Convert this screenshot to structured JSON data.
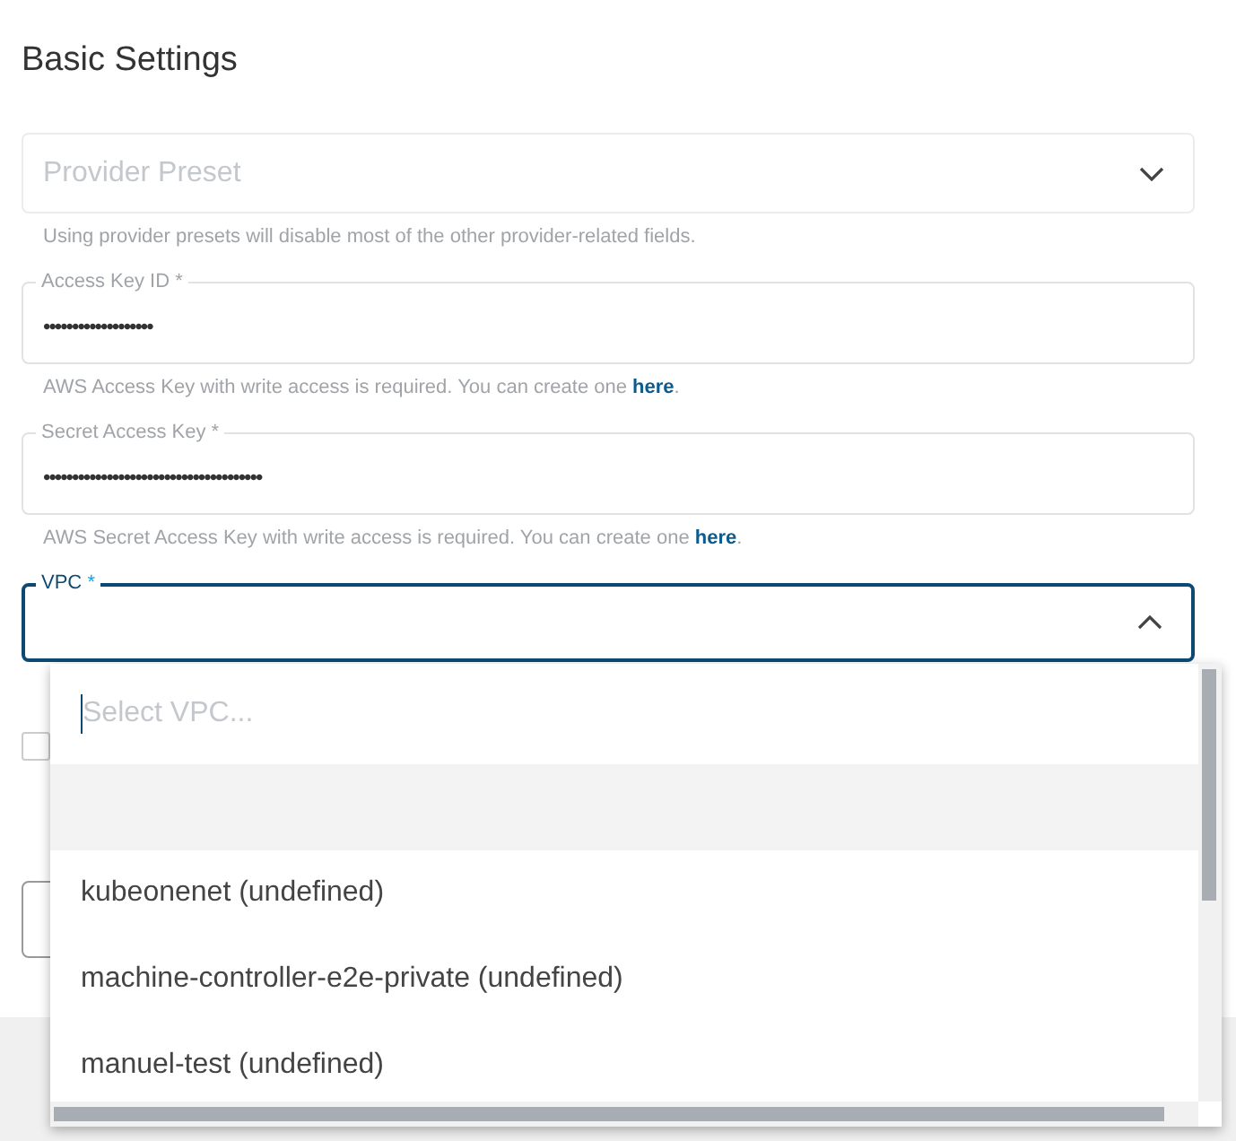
{
  "heading": "Basic Settings",
  "provider_preset": {
    "placeholder": "Provider Preset",
    "hint": "Using provider presets will disable most of the other provider-related fields."
  },
  "fields": [
    {
      "label": "Access Key ID *",
      "value": "•••••••••••••••••••",
      "hint": "AWS Access Key with write access is required. You can create one",
      "link": "here",
      "hint_end": "."
    },
    {
      "label": "Secret Access Key *",
      "value": "••••••••••••••••••••••••••••••••••••••",
      "hint": "AWS Secret Access Key with write access is required. You can create one",
      "link": "here",
      "hint_end": "."
    }
  ],
  "vpc": {
    "label": "VPC",
    "required_mark": "*",
    "focused": true,
    "expanded": true
  },
  "checkbox": {
    "checked": false
  },
  "dropdown": {
    "search_placeholder": "Select VPC...",
    "options": [
      {
        "kind": "blank",
        "highlighted": true
      },
      {
        "kind": "text",
        "label": "kubeonenet (undefined)",
        "highlighted": false
      },
      {
        "kind": "text",
        "label": "machine-controller-e2e-private (undefined)",
        "highlighted": false
      },
      {
        "kind": "text",
        "label": "manuel-test (undefined)",
        "highlighted": false
      }
    ]
  }
}
